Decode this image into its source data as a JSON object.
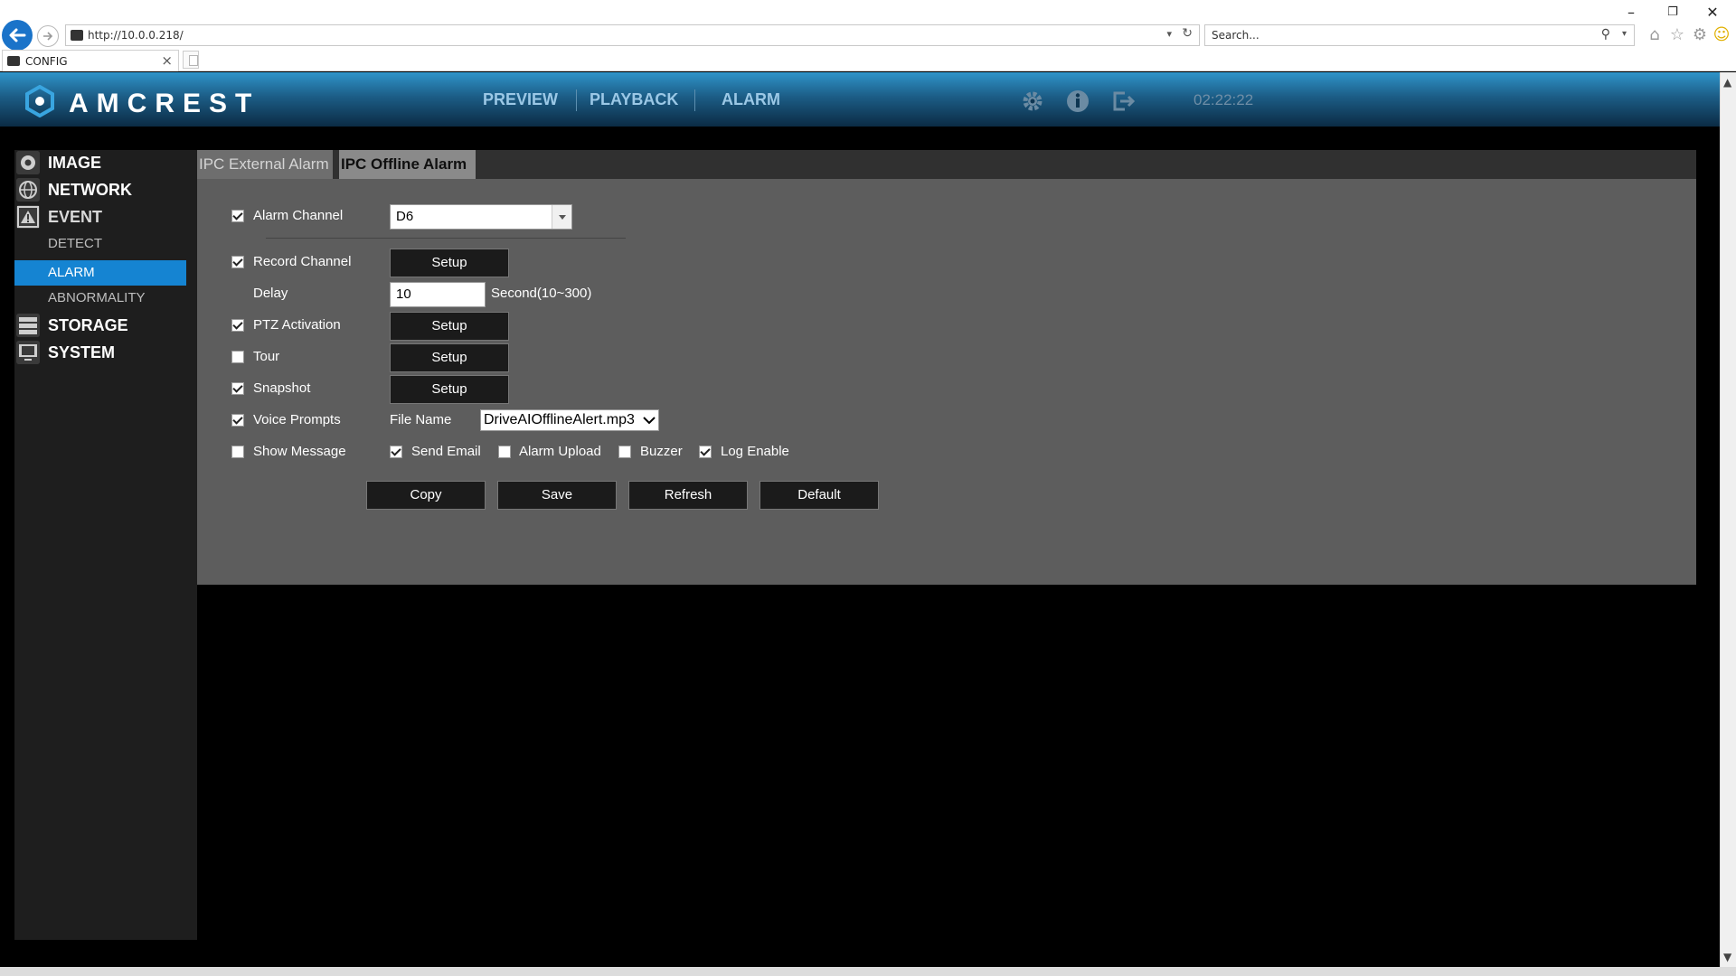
{
  "browser": {
    "url": "http://10.0.0.218/",
    "search_placeholder": "Search...",
    "tab_title": "CONFIG",
    "tab_close": "×",
    "window_minimize": "–",
    "window_restore": "❐",
    "window_close": "✕",
    "search_glyph": "⚲",
    "dropdown_glyph": "▾",
    "refresh_glyph": "↻",
    "home_glyph": "⌂",
    "star_glyph": "☆",
    "gear_glyph": "⚙",
    "smile_glyph": "☺",
    "scroll_up": "▲",
    "scroll_down": "▼"
  },
  "header": {
    "logo_text": "AMCREST",
    "nav": [
      "PREVIEW",
      "PLAYBACK",
      "ALARM"
    ],
    "time": "02:22:22",
    "icons": [
      "settings-icon",
      "info-icon",
      "logout-icon"
    ],
    "accent": "#1584d2"
  },
  "sidebar": {
    "items": [
      {
        "label": "IMAGE",
        "type": "main",
        "icon": "camera-icon"
      },
      {
        "label": "NETWORK",
        "type": "main",
        "icon": "globe-icon"
      },
      {
        "label": "EVENT",
        "type": "main",
        "icon": "warning-icon"
      },
      {
        "label": "DETECT",
        "type": "sub"
      },
      {
        "label": "ALARM",
        "type": "sub",
        "active": true
      },
      {
        "label": "ABNORMALITY",
        "type": "sub"
      },
      {
        "label": "STORAGE",
        "type": "main",
        "icon": "storage-icon"
      },
      {
        "label": "SYSTEM",
        "type": "main",
        "icon": "monitor-icon"
      }
    ]
  },
  "tabs": [
    "IPC External Alarm",
    "IPC Offline Alarm"
  ],
  "form": {
    "alarm_channel": {
      "label": "Alarm Channel",
      "checked": true,
      "value": "D6"
    },
    "record_channel": {
      "label": "Record Channel",
      "checked": true,
      "button": "Setup"
    },
    "delay": {
      "label": "Delay",
      "value": "10",
      "unit": "Second(10~300)"
    },
    "ptz_activation": {
      "label": "PTZ Activation",
      "checked": true,
      "button": "Setup"
    },
    "tour": {
      "label": "Tour",
      "checked": false,
      "button": "Setup"
    },
    "snapshot": {
      "label": "Snapshot",
      "checked": true,
      "button": "Setup"
    },
    "voice_prompts": {
      "label": "Voice Prompts",
      "checked": true,
      "file_label": "File Name",
      "file_value": "DriveAIOfflineAlert.mp3"
    },
    "show_message": {
      "label": "Show Message",
      "checked": false
    },
    "send_email": {
      "label": "Send Email",
      "checked": true
    },
    "alarm_upload": {
      "label": "Alarm Upload",
      "checked": false
    },
    "buzzer": {
      "label": "Buzzer",
      "checked": false
    },
    "log_enable": {
      "label": "Log Enable",
      "checked": true
    }
  },
  "actions": [
    "Copy",
    "Save",
    "Refresh",
    "Default"
  ]
}
